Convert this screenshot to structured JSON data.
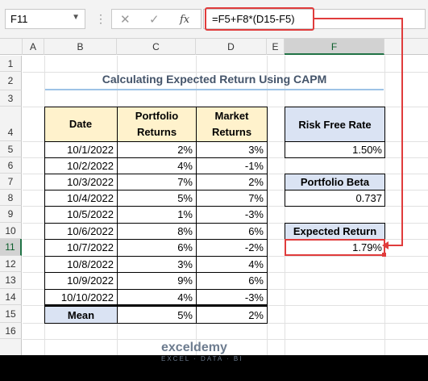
{
  "formula_bar": {
    "name_box": "F11",
    "cancel_icon": "✕",
    "enter_icon": "✓",
    "fx_label": "fx",
    "formula": "=F5+F8*(D15-F5)"
  },
  "columns": [
    "A",
    "B",
    "C",
    "D",
    "E",
    "F"
  ],
  "rows": [
    "1",
    "2",
    "3",
    "4",
    "5",
    "6",
    "7",
    "8",
    "9",
    "10",
    "11",
    "12",
    "13",
    "14",
    "15",
    "16"
  ],
  "sheet": {
    "title": "Calculating Expected Return Using CAPM",
    "table_headers": {
      "date": "Date",
      "portfolio": "Portfolio Returns",
      "market": "Market Returns"
    },
    "data": [
      {
        "date": "10/1/2022",
        "portfolio": "2%",
        "market": "3%"
      },
      {
        "date": "10/2/2022",
        "portfolio": "4%",
        "market": "-1%"
      },
      {
        "date": "10/3/2022",
        "portfolio": "7%",
        "market": "2%"
      },
      {
        "date": "10/4/2022",
        "portfolio": "5%",
        "market": "7%"
      },
      {
        "date": "10/5/2022",
        "portfolio": "1%",
        "market": "-3%"
      },
      {
        "date": "10/6/2022",
        "portfolio": "8%",
        "market": "6%"
      },
      {
        "date": "10/7/2022",
        "portfolio": "6%",
        "market": "-2%"
      },
      {
        "date": "10/8/2022",
        "portfolio": "3%",
        "market": "4%"
      },
      {
        "date": "10/9/2022",
        "portfolio": "9%",
        "market": "6%"
      },
      {
        "date": "10/10/2022",
        "portfolio": "4%",
        "market": "-3%"
      }
    ],
    "mean": {
      "label": "Mean",
      "portfolio": "5%",
      "market": "2%"
    },
    "risk_free": {
      "label": "Risk Free Rate",
      "value": "1.50%"
    },
    "beta": {
      "label": "Portfolio Beta",
      "value": "0.737"
    },
    "expected": {
      "label": "Expected Return",
      "value": "1.79%"
    }
  },
  "watermark": {
    "brand": "exceldemy",
    "tagline": "EXCEL · DATA · BI"
  },
  "colors": {
    "header_fill": "#fff2cc",
    "label_fill": "#dae3f3",
    "highlight": "#e03c3c",
    "selection": "#217346"
  }
}
